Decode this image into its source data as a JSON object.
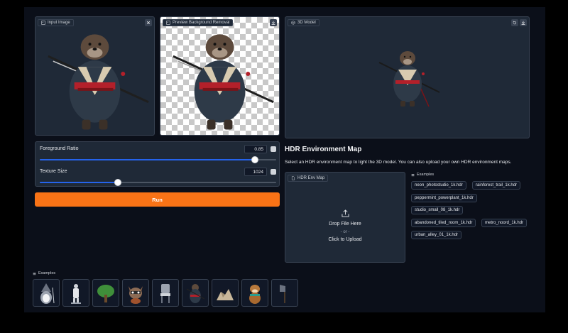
{
  "input_image": {
    "label": "Input Image"
  },
  "preview": {
    "label": "Preview Background Removal"
  },
  "model3d": {
    "label": "3D Model"
  },
  "sliders": {
    "foreground_ratio": {
      "label": "Foreground Ratio",
      "value": "0.85",
      "fraction": 0.91
    },
    "texture_size": {
      "label": "Texture Size",
      "value": "1024",
      "fraction": 0.33
    }
  },
  "run_button": {
    "label": "Run"
  },
  "hdr": {
    "title": "HDR Environment Map",
    "description": "Select an HDR environment map to light the 3D model. You can also upload your own HDR environment maps.",
    "panel_label": "HDR Env Map",
    "drop_text": "Drop File Here",
    "or_text": "- or -",
    "click_text": "Click to Upload",
    "examples_label": "Examples",
    "examples": [
      "neon_photostudio_1k.hdr",
      "rainforest_trail_1k.hdr",
      "peppermint_powerplant_1k.hdr",
      "studio_small_08_1k.hdr",
      "abandoned_tiled_room_1k.hdr",
      "metro_noord_1k.hdr",
      "urban_alley_01_1k.hdr"
    ]
  },
  "bottom_examples": {
    "label": "Examples",
    "items": [
      "penguin-wizard",
      "statue",
      "tree",
      "raccoon",
      "chair",
      "samurai-otter",
      "rocks",
      "otter",
      "axe"
    ]
  },
  "colors": {
    "accent": "#f97316",
    "slider": "#2563eb",
    "background": "#0b0f19",
    "panel": "#1f2937"
  }
}
